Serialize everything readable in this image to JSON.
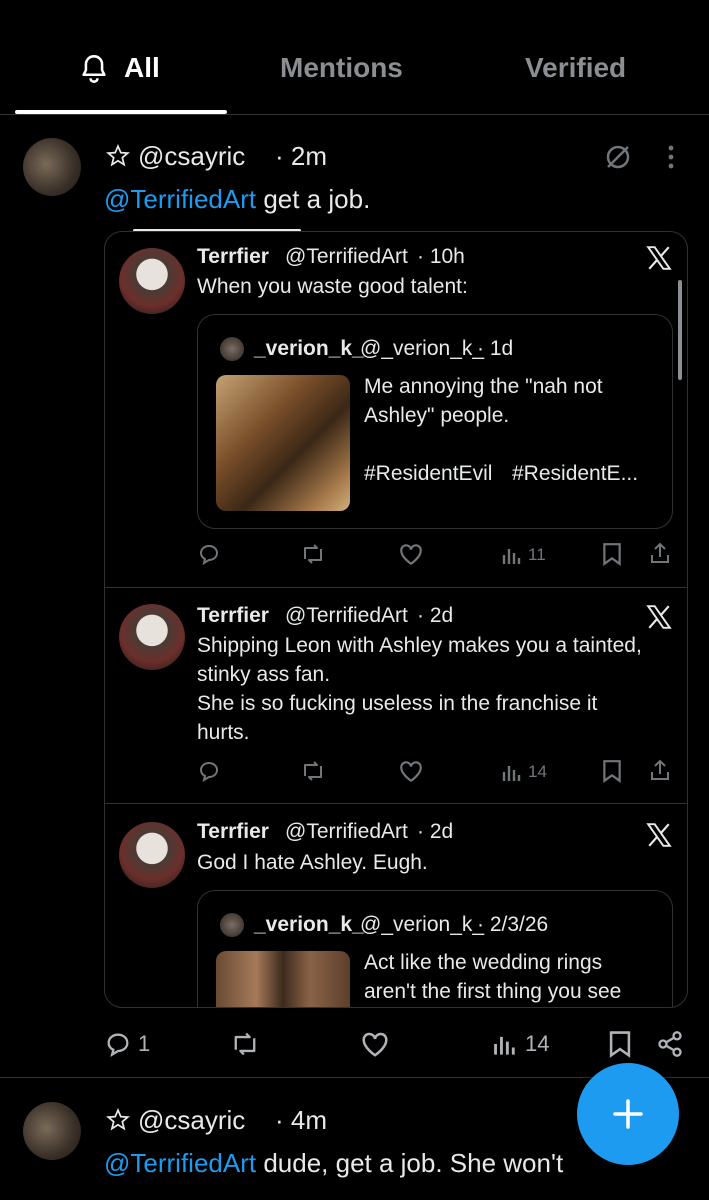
{
  "tabs": {
    "all": "All",
    "mentions": "Mentions",
    "verified": "Verified"
  },
  "post1": {
    "handle": "@csayric",
    "time": "· 2m",
    "mention": "@TerrifiedArt",
    "text": " get a job."
  },
  "q1": {
    "name": "Terrfier",
    "handle": "@TerrifiedArt",
    "time": "· 10h",
    "text": "When you waste good talent:"
  },
  "q1inner": {
    "name": "_verion_k_",
    "handle": "@_verion_k_",
    "time": "· 1d",
    "line1": "Me annoying the \"nah not",
    "line2": "Ashley\" people.",
    "tag1": "#ResidentEvil",
    "tag2": "#ResidentE..."
  },
  "q1stats": {
    "views": "11"
  },
  "q2": {
    "name": "Terrfier",
    "handle": "@TerrifiedArt",
    "time": "· 2d",
    "line1": "Shipping Leon with Ashley makes you a tainted,",
    "line2": "stinky ass fan.",
    "line3": "She is so fucking useless in the franchise it",
    "line4": "hurts."
  },
  "q2stats": {
    "views": "14"
  },
  "q3": {
    "name": "Terrfier",
    "handle": "@TerrifiedArt",
    "time": "· 2d",
    "text": "God I hate Ashley. Eugh."
  },
  "q3inner": {
    "name": "_verion_k_",
    "handle": "@_verion_k_",
    "time": "· 2/3/26",
    "line1": "Act like the wedding rings",
    "line2": "aren't the first thing you see"
  },
  "post1stats": {
    "replies": "1",
    "views": "14"
  },
  "post2": {
    "handle": "@csayric",
    "time": "· 4m",
    "mention": "@TerrifiedArt",
    "text": " dude, get a job. She won't"
  },
  "colors": {
    "accent": "#1d9bf0",
    "bg": "#000000",
    "border": "#2f3336",
    "muted": "#71767b"
  }
}
